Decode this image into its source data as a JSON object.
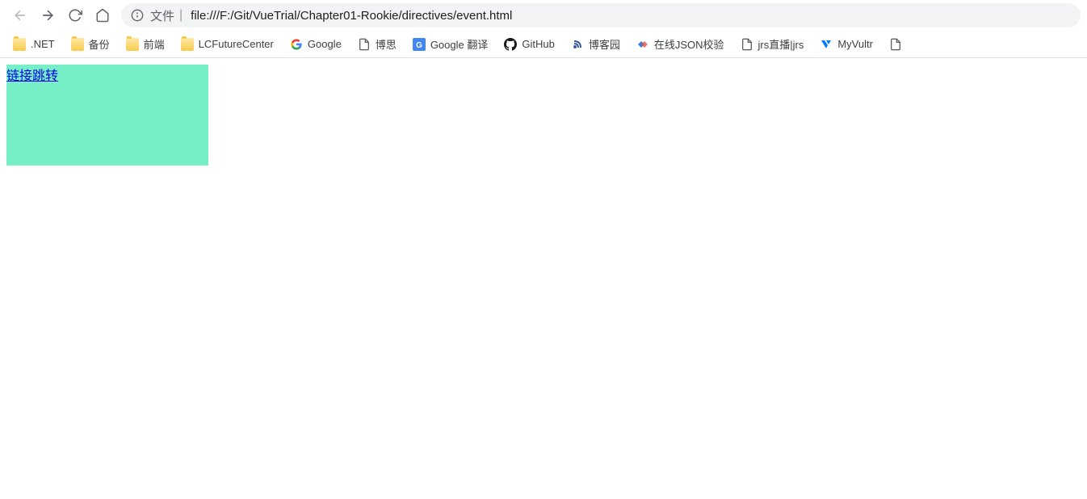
{
  "toolbar": {
    "address_prefix": "文件",
    "url": "file:///F:/Git/VueTrial/Chapter01-Rookie/directives/event.html"
  },
  "bookmarks": [
    {
      "label": ".NET",
      "icon": "folder"
    },
    {
      "label": "备份",
      "icon": "folder"
    },
    {
      "label": "前端",
      "icon": "folder"
    },
    {
      "label": "LCFutureCenter",
      "icon": "folder"
    },
    {
      "label": "Google",
      "icon": "google"
    },
    {
      "label": "博思",
      "icon": "page"
    },
    {
      "label": "Google 翻译",
      "icon": "translate"
    },
    {
      "label": "GitHub",
      "icon": "github"
    },
    {
      "label": "博客园",
      "icon": "cnblogs"
    },
    {
      "label": "在线JSON校验",
      "icon": "json"
    },
    {
      "label": "jrs直播|jrs",
      "icon": "page"
    },
    {
      "label": "MyVultr",
      "icon": "vultr"
    }
  ],
  "page": {
    "link_text": "链接跳转"
  }
}
